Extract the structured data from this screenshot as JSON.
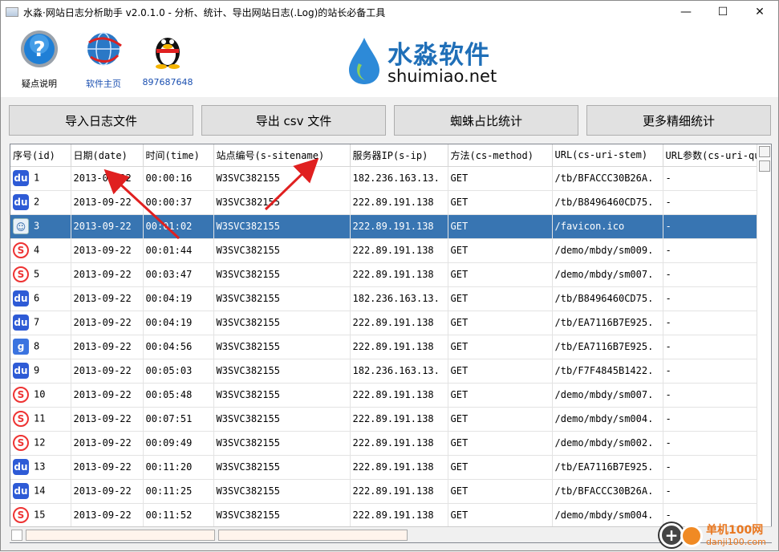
{
  "window": {
    "title": "水淼·网站日志分析助手 v2.0.1.0 - 分析、统计、导出网站日志(.Log)的站长必备工具",
    "controls": [
      "—",
      "☐",
      "✕"
    ]
  },
  "toolbar": {
    "items": [
      {
        "label": "疑点说明",
        "icon": "question-icon"
      },
      {
        "label": "软件主页",
        "icon": "globe-icon"
      },
      {
        "label": "897687648",
        "icon": "qq-penguin-icon"
      }
    ],
    "logo_cn": "水淼软件",
    "logo_en": "shuimiao.net"
  },
  "actions": {
    "import_label": "导入日志文件",
    "export_label": "导出 csv 文件",
    "spider_label": "蜘蛛占比统计",
    "more_label": "更多精细统计"
  },
  "table": {
    "columns": [
      "序号(id)",
      "日期(date)",
      "时间(time)",
      "站点编号(s-sitename)",
      "服务器IP(s-ip)",
      "方法(cs-method)",
      "URL(cs-uri-stem)",
      "URL参数(cs-uri-qu"
    ],
    "rows": [
      {
        "icon": "baidu",
        "id": "1",
        "date": "2013-09-22",
        "time": "00:00:16",
        "site": "W3SVC382155",
        "ip": "182.236.163.13.",
        "method": "GET",
        "url": "/tb/BFACCC30B26A.",
        "query": "-"
      },
      {
        "icon": "baidu",
        "id": "2",
        "date": "2013-09-22",
        "time": "00:00:37",
        "site": "W3SVC382155",
        "ip": "222.89.191.138",
        "method": "GET",
        "url": "/tb/B8496460CD75.",
        "query": "-"
      },
      {
        "icon": "user",
        "id": "3",
        "date": "2013-09-22",
        "time": "00:01:02",
        "site": "W3SVC382155",
        "ip": "222.89.191.138",
        "method": "GET",
        "url": "/favicon.ico",
        "query": "-",
        "selected": true
      },
      {
        "icon": "sogou",
        "id": "4",
        "date": "2013-09-22",
        "time": "00:01:44",
        "site": "W3SVC382155",
        "ip": "222.89.191.138",
        "method": "GET",
        "url": "/demo/mbdy/sm009.",
        "query": "-"
      },
      {
        "icon": "sogou",
        "id": "5",
        "date": "2013-09-22",
        "time": "00:03:47",
        "site": "W3SVC382155",
        "ip": "222.89.191.138",
        "method": "GET",
        "url": "/demo/mbdy/sm007.",
        "query": "-"
      },
      {
        "icon": "baidu",
        "id": "6",
        "date": "2013-09-22",
        "time": "00:04:19",
        "site": "W3SVC382155",
        "ip": "182.236.163.13.",
        "method": "GET",
        "url": "/tb/B8496460CD75.",
        "query": "-"
      },
      {
        "icon": "baidu",
        "id": "7",
        "date": "2013-09-22",
        "time": "00:04:19",
        "site": "W3SVC382155",
        "ip": "222.89.191.138",
        "method": "GET",
        "url": "/tb/EA7116B7E925.",
        "query": "-"
      },
      {
        "icon": "google",
        "id": "8",
        "date": "2013-09-22",
        "time": "00:04:56",
        "site": "W3SVC382155",
        "ip": "222.89.191.138",
        "method": "GET",
        "url": "/tb/EA7116B7E925.",
        "query": "-"
      },
      {
        "icon": "baidu",
        "id": "9",
        "date": "2013-09-22",
        "time": "00:05:03",
        "site": "W3SVC382155",
        "ip": "182.236.163.13.",
        "method": "GET",
        "url": "/tb/F7F4845B1422.",
        "query": "-"
      },
      {
        "icon": "sogou",
        "id": "10",
        "date": "2013-09-22",
        "time": "00:05:48",
        "site": "W3SVC382155",
        "ip": "222.89.191.138",
        "method": "GET",
        "url": "/demo/mbdy/sm007.",
        "query": "-"
      },
      {
        "icon": "sogou",
        "id": "11",
        "date": "2013-09-22",
        "time": "00:07:51",
        "site": "W3SVC382155",
        "ip": "222.89.191.138",
        "method": "GET",
        "url": "/demo/mbdy/sm004.",
        "query": "-"
      },
      {
        "icon": "sogou",
        "id": "12",
        "date": "2013-09-22",
        "time": "00:09:49",
        "site": "W3SVC382155",
        "ip": "222.89.191.138",
        "method": "GET",
        "url": "/demo/mbdy/sm002.",
        "query": "-"
      },
      {
        "icon": "baidu",
        "id": "13",
        "date": "2013-09-22",
        "time": "00:11:20",
        "site": "W3SVC382155",
        "ip": "222.89.191.138",
        "method": "GET",
        "url": "/tb/EA7116B7E925.",
        "query": "-"
      },
      {
        "icon": "baidu",
        "id": "14",
        "date": "2013-09-22",
        "time": "00:11:25",
        "site": "W3SVC382155",
        "ip": "222.89.191.138",
        "method": "GET",
        "url": "/tb/BFACCC30B26A.",
        "query": "-"
      },
      {
        "icon": "sogou",
        "id": "15",
        "date": "2013-09-22",
        "time": "00:11:52",
        "site": "W3SVC382155",
        "ip": "222.89.191.138",
        "method": "GET",
        "url": "/demo/mbdy/sm004.",
        "query": "-"
      }
    ]
  },
  "icon_glyphs": {
    "baidu": "du",
    "sogou": "S",
    "google": "g",
    "user": "☺"
  },
  "watermark": {
    "cn": "单机100网",
    "en": "danji100.com"
  },
  "colors": {
    "selection": "#3875b2",
    "logo_blue": "#1f6fb8",
    "arrow_red": "#e02020",
    "watermark_orange": "#e9771f"
  }
}
